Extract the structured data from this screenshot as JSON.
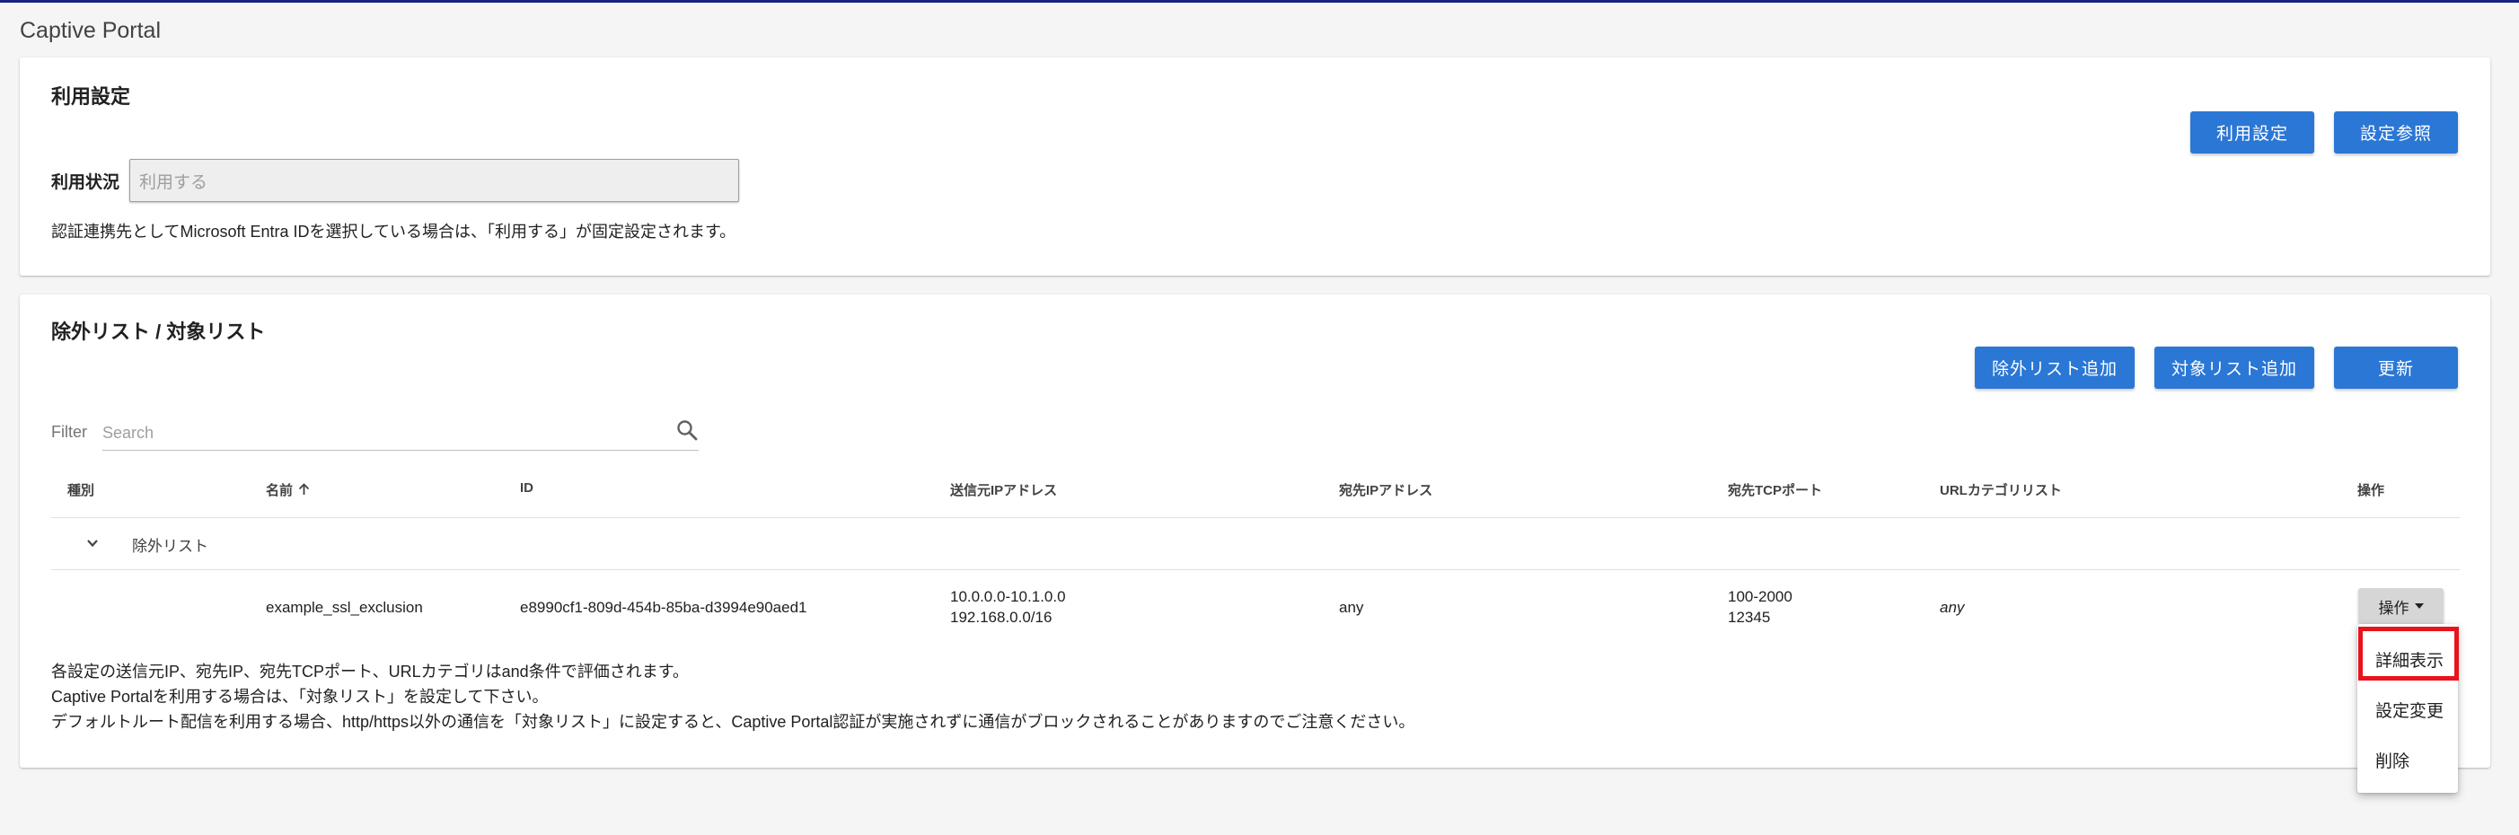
{
  "page": {
    "title": "Captive Portal"
  },
  "usage_settings": {
    "title": "利用設定",
    "buttons": {
      "usage_settings": "利用設定",
      "view_settings": "設定参照"
    },
    "status_label": "利用状況",
    "status_value": "利用する",
    "note": "認証連携先としてMicrosoft Entra IDを選択している場合は、「利用する」が固定設定されます。"
  },
  "lists": {
    "title": "除外リスト / 対象リスト",
    "buttons": {
      "add_exclusion": "除外リスト追加",
      "add_target": "対象リスト追加",
      "refresh": "更新"
    },
    "filter_label": "Filter",
    "search_placeholder": "Search",
    "columns": {
      "type": "種別",
      "name": "名前",
      "id": "ID",
      "src_ip": "送信元IPアドレス",
      "dst_ip": "宛先IPアドレス",
      "dst_port": "宛先TCPポート",
      "url_category": "URLカテゴリリスト",
      "actions": "操作"
    },
    "group_label": "除外リスト",
    "rows": [
      {
        "name": "example_ssl_exclusion",
        "id": "e8990cf1-809d-454b-85ba-d3994e90aed1",
        "src_ip_1": "10.0.0.0-10.1.0.0",
        "src_ip_2": "192.168.0.0/16",
        "dst_ip": "any",
        "dst_port_1": "100-2000",
        "dst_port_2": "12345",
        "url_category": "any",
        "action_label": "操作"
      }
    ],
    "notes": [
      "各設定の送信元IP、宛先IP、宛先TCPポート、URLカテゴリはand条件で評価されます。",
      "Captive Portalを利用する場合は、「対象リスト」を設定して下さい。",
      "デフォルトルート配信を利用する場合、http/https以外の通信を「対象リスト」に設定すると、Captive Portal認証が実施されずに通信がブロックされることがありますのでご注意ください。"
    ],
    "action_menu": {
      "detail": "詳細表示",
      "edit": "設定変更",
      "delete": "削除"
    }
  },
  "colors": {
    "primary": "#2a77d5",
    "highlight": "#e8131d",
    "top_bar": "#1a237e"
  }
}
